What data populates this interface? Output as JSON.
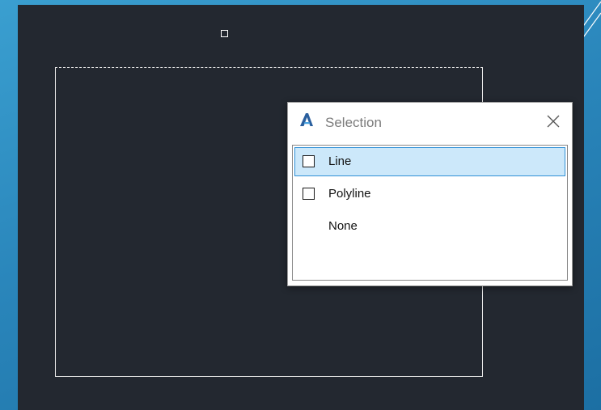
{
  "dialog": {
    "title": "Selection",
    "close_icon": "close-icon",
    "app_icon": "autocad-a-icon",
    "accent": "#2f8fd6",
    "items": [
      {
        "label": "Line",
        "checkbox": true,
        "selected": true
      },
      {
        "label": "Polyline",
        "checkbox": true,
        "selected": false
      },
      {
        "label": "None",
        "checkbox": false,
        "selected": false
      }
    ]
  },
  "colors": {
    "canvas": "#232830",
    "background": "#2a86bb",
    "selection_highlight": "#cce8fa"
  }
}
